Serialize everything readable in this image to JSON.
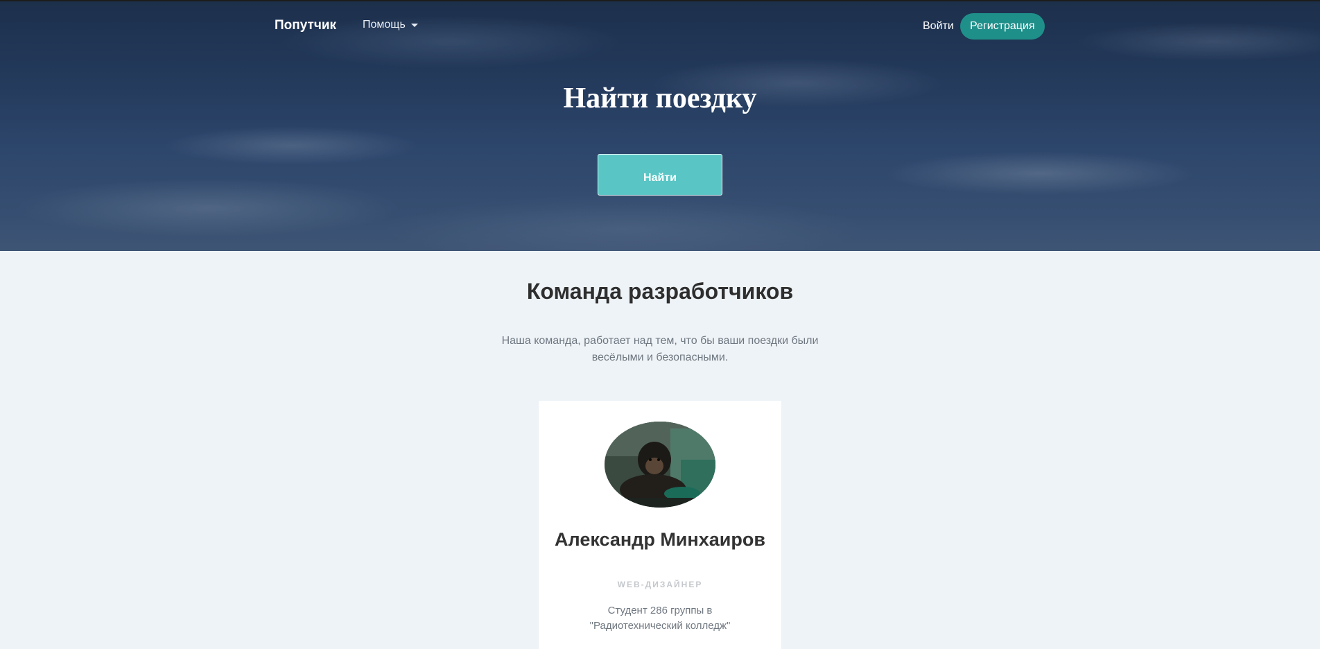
{
  "nav": {
    "brand": "Попутчик",
    "help_label": "Помощь",
    "login_label": "Войти",
    "register_label": "Регистрация"
  },
  "hero": {
    "title": "Найти поездку",
    "find_button": "Найти"
  },
  "team": {
    "title": "Команда разработчиков",
    "description": "Наша команда, работает над тем, что бы ваши поездки были весёлыми и безопасными.",
    "members": [
      {
        "name": "Александр Минхаиров",
        "role": "WEB-ДИЗАЙНЕР",
        "description": "Студент 286 группы в \"Радиотехнический колледж\""
      }
    ]
  },
  "colors": {
    "accent": "#1f8f8a",
    "button": "#59c6c5",
    "background": "#eef3f7"
  }
}
